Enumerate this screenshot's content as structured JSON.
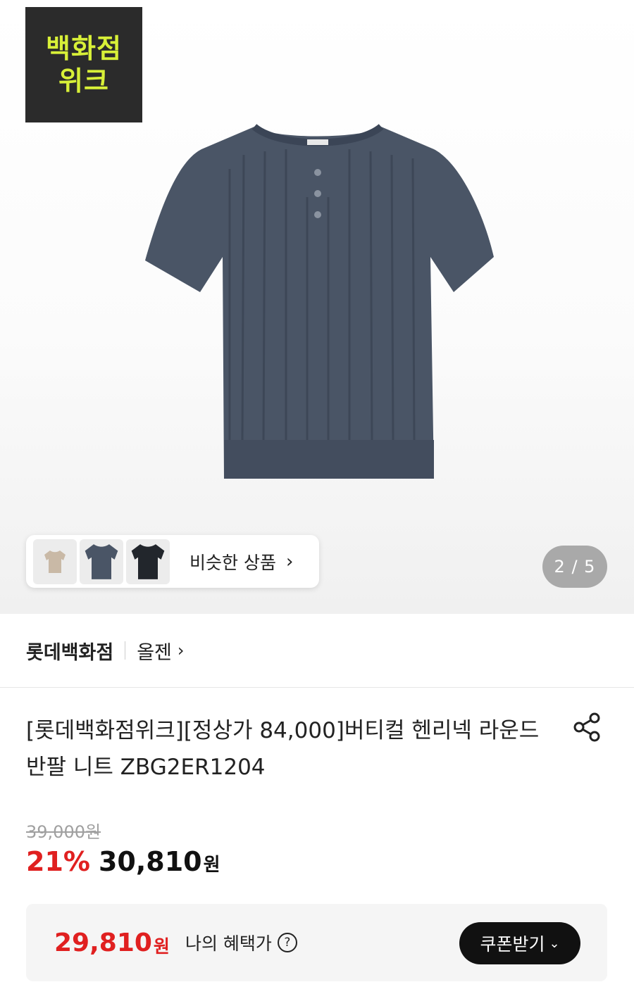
{
  "badge": {
    "line1": "백화점",
    "line2": "위크"
  },
  "similar": {
    "label": "비슷한 상품",
    "chevron": "›"
  },
  "gallery": {
    "counter": "2 / 5"
  },
  "store": {
    "name": "롯데백화점",
    "brand": "올젠",
    "chevron": "›"
  },
  "product": {
    "title": "[롯데백화점위크][정상가 84,000]버티컬 헨리넥 라운드 반팔 니트 ZBG2ER1204",
    "original_price": "39,000원",
    "discount": "21%",
    "sale_price": "30,810",
    "won": "원"
  },
  "benefit": {
    "price": "29,810",
    "won": "원",
    "label": "나의 혜택가",
    "help": "?",
    "coupon_label": "쿠폰받기",
    "coupon_chevron": "⌄"
  },
  "colors": {
    "discount_red": "#e02020",
    "badge_bg": "#2b2b2b",
    "badge_text": "#d8f038",
    "shirt": "#4a5566"
  },
  "icons": [
    "share-icon",
    "question-icon",
    "chevron-right-icon"
  ]
}
